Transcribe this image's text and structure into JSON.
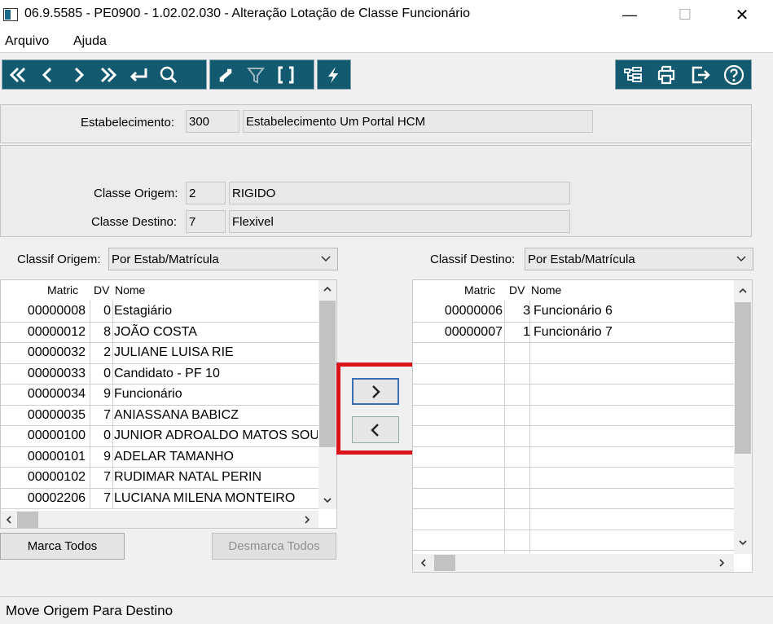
{
  "window": {
    "title": "06.9.5585 - PE0900 - 1.02.02.030 - Alteração Lotação de Classe Funcionário",
    "minimize": "—",
    "maximize": "☐",
    "close": "✕"
  },
  "menu": {
    "items": [
      "Arquivo",
      "Ajuda"
    ]
  },
  "toolbar": {
    "nav_icons": [
      "first-icon",
      "previous-icon",
      "next-icon",
      "last-icon",
      "goto-icon",
      "search-icon"
    ],
    "filter_icons": [
      "refresh-icon",
      "filter-icon",
      "brackets-icon"
    ],
    "action_icons": [
      "lightning-icon"
    ],
    "right_icons": [
      "tree-icon",
      "print-icon",
      "exit-icon",
      "help-icon"
    ]
  },
  "estabelecimento": {
    "label": "Estabelecimento:",
    "code": "300",
    "name": "Estabelecimento Um Portal HCM"
  },
  "classe_origem": {
    "label": "Classe Origem:",
    "code": "2",
    "name": "RIGIDO"
  },
  "classe_destino": {
    "label": "Classe Destino:",
    "code": "7",
    "name": "Flexivel"
  },
  "classif_origem": {
    "label": "Classif Origem:",
    "value": "Por Estab/Matrícula"
  },
  "classif_destino": {
    "label": "Classif Destino:",
    "value": "Por Estab/Matrícula"
  },
  "grid_columns": {
    "matric": "Matric",
    "dv": "DV",
    "nome": "Nome"
  },
  "origem_rows": [
    {
      "matric": "00000008",
      "dv": "0",
      "nome": "Estagiário"
    },
    {
      "matric": "00000012",
      "dv": "8",
      "nome": "JOÃO COSTA"
    },
    {
      "matric": "00000032",
      "dv": "2",
      "nome": "JULIANE LUISA RIE"
    },
    {
      "matric": "00000033",
      "dv": "0",
      "nome": "Candidato -  PF 10"
    },
    {
      "matric": "00000034",
      "dv": "9",
      "nome": "Funcionário"
    },
    {
      "matric": "00000035",
      "dv": "7",
      "nome": "ANIASSANA BABICZ"
    },
    {
      "matric": "00000100",
      "dv": "0",
      "nome": "JUNIOR ADROALDO MATOS SOUZA"
    },
    {
      "matric": "00000101",
      "dv": "9",
      "nome": "ADELAR TAMANHO"
    },
    {
      "matric": "00000102",
      "dv": "7",
      "nome": "RUDIMAR NATAL PERIN"
    },
    {
      "matric": "00002206",
      "dv": "7",
      "nome": "LUCIANA MILENA MONTEIRO"
    }
  ],
  "destino_rows": [
    {
      "matric": "00000006",
      "dv": "3",
      "nome": "Funcionário 6"
    },
    {
      "matric": "00000007",
      "dv": "1",
      "nome": "Funcionário 7"
    }
  ],
  "buttons": {
    "marca_todos": "Marca Todos",
    "desmarca_todos": "Desmarca Todos"
  },
  "transfer": {
    "highlight_color": "#d9121b"
  },
  "status": {
    "text": "Move Origem Para Destino"
  }
}
